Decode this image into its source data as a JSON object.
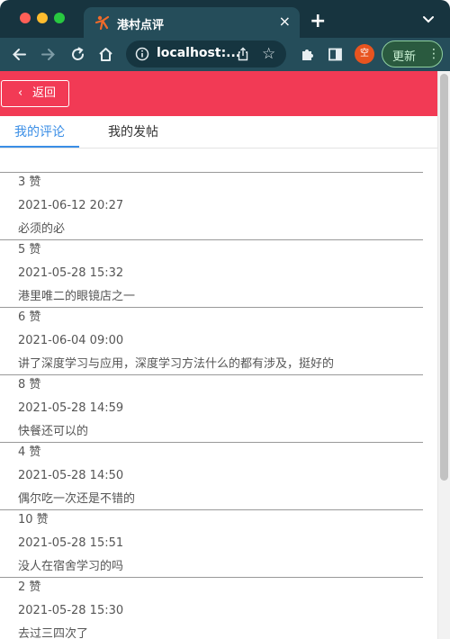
{
  "browser": {
    "tab_title": "港村点评",
    "tab_close": "×",
    "new_tab": "+",
    "url": "localhost:...",
    "profile_initial": "空",
    "update_label": "更新",
    "update_menu": "⋮",
    "favicon_color": "#f06a2a"
  },
  "header": {
    "back_chevron": "‹",
    "back_label": "返回",
    "color": "#f23a55"
  },
  "tabs": [
    {
      "label": "我的评论",
      "active": true
    },
    {
      "label": "我的发帖",
      "active": false
    }
  ],
  "comments": [
    {
      "likes": "3 赞",
      "time": "2021-06-12 20:27",
      "text": "必须的必"
    },
    {
      "likes": "5 赞",
      "time": "2021-05-28 15:32",
      "text": "港里唯二的眼镜店之一"
    },
    {
      "likes": "6 赞",
      "time": "2021-06-04 09:00",
      "text": "讲了深度学习与应用，深度学习方法什么的都有涉及，挺好的"
    },
    {
      "likes": "8 赞",
      "time": "2021-05-28 14:59",
      "text": "快餐还可以的"
    },
    {
      "likes": "4 赞",
      "time": "2021-05-28 14:50",
      "text": "偶尔吃一次还是不错的"
    },
    {
      "likes": "10 赞",
      "time": "2021-05-28 15:51",
      "text": "没人在宿舍学习的吗"
    },
    {
      "likes": "2 赞",
      "time": "2021-05-28 15:30",
      "text": "去过三四次了"
    }
  ]
}
